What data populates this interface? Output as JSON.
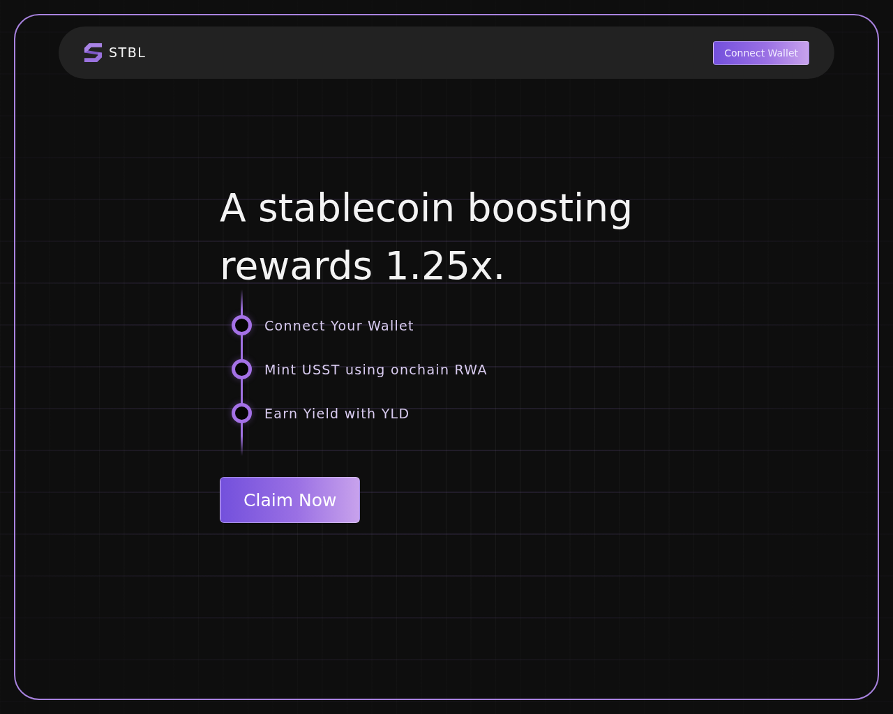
{
  "header": {
    "brand": "STBL",
    "connect_button": "Connect Wallet"
  },
  "hero": {
    "title": "A stablecoin boosting rewards 1.25x.",
    "steps": [
      {
        "label": "Connect Your Wallet"
      },
      {
        "label": "Mint USST using onchain RWA"
      },
      {
        "label": "Earn Yield with YLD"
      }
    ],
    "cta_button": "Claim Now"
  }
}
